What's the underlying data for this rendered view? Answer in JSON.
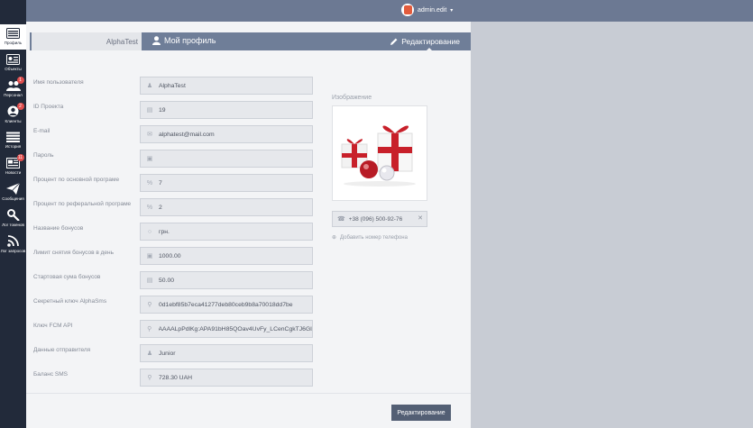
{
  "header": {
    "user_name": "admin.edit"
  },
  "sidebar": {
    "items": [
      {
        "label": "Профиль",
        "icon": "profile-card-icon",
        "active": true
      },
      {
        "label": "Объекты",
        "icon": "objects-icon"
      },
      {
        "label": "Персонал",
        "icon": "staff-icon",
        "badge": "1"
      },
      {
        "label": "Клиенты",
        "icon": "clients-icon",
        "badge": "2"
      },
      {
        "label": "История",
        "icon": "history-icon"
      },
      {
        "label": "Новости",
        "icon": "news-icon",
        "badge": "11"
      },
      {
        "label": "Сообщения",
        "icon": "messages-icon"
      },
      {
        "label": "Лог токенов",
        "icon": "token-log-icon"
      },
      {
        "label": "Лог запросов",
        "icon": "request-log-icon"
      }
    ]
  },
  "tabs": {
    "left_label": "AlphaTest",
    "profile_label": "Мой профиль",
    "edit_label": "Редактирование"
  },
  "form": {
    "fields": [
      {
        "label": "Имя пользователя",
        "icon": "user-icon",
        "value": "AlphaTest"
      },
      {
        "label": "ID Проекта",
        "icon": "id-icon",
        "value": "19"
      },
      {
        "label": "E-mail",
        "icon": "mail-icon",
        "value": "alphatest@mail.com"
      },
      {
        "label": "Пароль",
        "icon": "lock-icon",
        "value": ""
      },
      {
        "label": "Процент по основной програме",
        "icon": "percent-icon",
        "value": "7"
      },
      {
        "label": "Процент по реферальной програме",
        "icon": "percent-icon",
        "value": "2"
      },
      {
        "label": "Название бонусов",
        "icon": "coins-icon",
        "value": "грн."
      },
      {
        "label": "Лимит снятия бонусов в день",
        "icon": "lock-icon",
        "value": "1000.00"
      },
      {
        "label": "Стартовая сума бонусов",
        "icon": "money-icon",
        "value": "50.00"
      },
      {
        "label": "Секретный ключ AlphaSms",
        "icon": "key-icon",
        "value": "0d1ebf85b7eca41277deb80ceb9b8a70018dd7be"
      },
      {
        "label": "Ключ FCM API",
        "icon": "key-icon",
        "value": "AAAALpPdlKg:APA91bH85QOav4UvFy_LCenCgkTJ6GlAuc"
      },
      {
        "label": "Данные отправителя",
        "icon": "user-icon",
        "value": "Junior"
      },
      {
        "label": "Баланс SMS",
        "icon": "key-icon",
        "value": "728.30 UAH"
      }
    ]
  },
  "image_section": {
    "label": "Изображение",
    "phone": "+38 (096) 500-92-76",
    "add_phone": "Добавить номер телефона"
  },
  "footer": {
    "edit_button": "Редактирование"
  },
  "colors": {
    "sidebar_bg": "#222a3a",
    "topbar_bg": "#6c7993",
    "accent": "#6f7e98",
    "badge": "#e04e4e",
    "button": "#535f74"
  }
}
